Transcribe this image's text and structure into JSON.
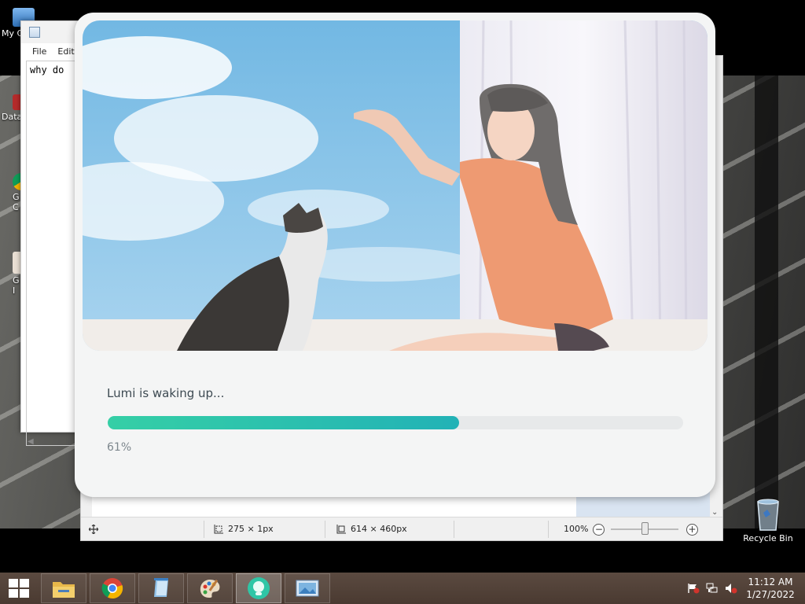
{
  "desktop": {
    "icons": [
      {
        "label": "My C"
      },
      {
        "label": "Data"
      },
      {
        "label": "G\nC"
      },
      {
        "label": "G\nI"
      }
    ],
    "recycle_bin_label": "Recycle Bin"
  },
  "notepad": {
    "menu": [
      "File",
      "Edit"
    ],
    "content": "why do"
  },
  "paint": {
    "status": {
      "selection": "275 × 1px",
      "image_size": "614 × 460px",
      "zoom": "100%",
      "zoom_out": "−",
      "zoom_in": "+"
    }
  },
  "splash": {
    "status_text": "Lumi is waking up...",
    "progress_label": "61%",
    "progress_value": 0.61,
    "colors": {
      "progress_start": "#35cfa6",
      "progress_end": "#22b2b6",
      "track": "#e7e9ea"
    }
  },
  "taskbar": {
    "apps": [
      {
        "name": "file-explorer",
        "icon": "folder-icon"
      },
      {
        "name": "chrome",
        "icon": "chrome-icon"
      },
      {
        "name": "notepad",
        "icon": "notepad-icon"
      },
      {
        "name": "paint",
        "icon": "palette-icon"
      },
      {
        "name": "lumi",
        "icon": "lumi-icon",
        "active": true
      },
      {
        "name": "photos",
        "icon": "photo-icon"
      }
    ],
    "time": "11:12 AM",
    "date": "1/27/2022"
  }
}
